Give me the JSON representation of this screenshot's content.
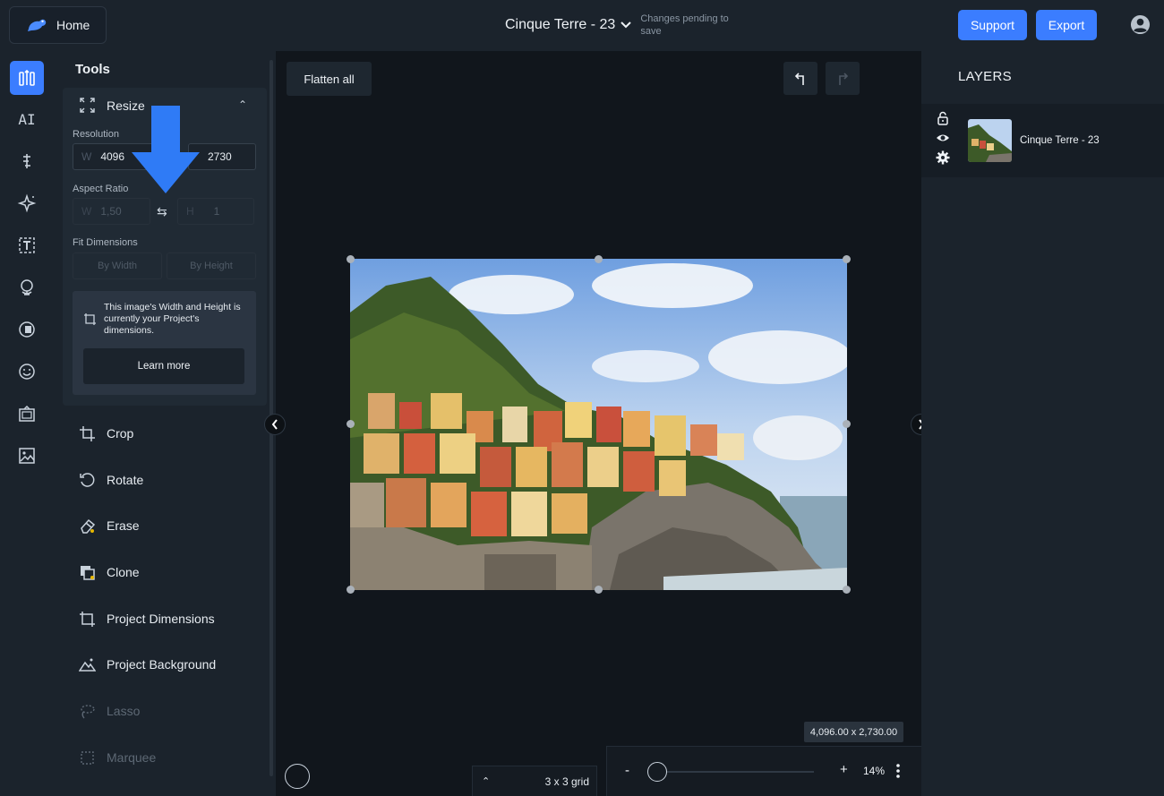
{
  "header": {
    "home_label": "Home",
    "project_title": "Cinque Terre - 23",
    "save_status": "Changes pending to save",
    "support_label": "Support",
    "export_label": "Export"
  },
  "rail": {
    "items": [
      {
        "name": "tools",
        "active": true
      },
      {
        "name": "ai",
        "label": "AI"
      },
      {
        "name": "adjustments"
      },
      {
        "name": "effects"
      },
      {
        "name": "text",
        "label": "T"
      },
      {
        "name": "elements"
      },
      {
        "name": "stickers"
      },
      {
        "name": "emoji"
      },
      {
        "name": "frames"
      },
      {
        "name": "images"
      }
    ]
  },
  "tools_panel": {
    "title": "Tools",
    "resize": {
      "label": "Resize",
      "resolution_label": "Resolution",
      "width_prefix": "W",
      "width_value": "4096",
      "height_value": "2730",
      "aspect_label": "Aspect Ratio",
      "aspect_w_prefix": "W",
      "aspect_w_value": "1,50",
      "aspect_h_prefix": "H",
      "aspect_h_value": "1",
      "fit_label": "Fit Dimensions",
      "fit_by_width": "By Width",
      "fit_by_height": "By Height",
      "info_text": "This image's Width and Height is currently your Project's dimensions.",
      "learn_more": "Learn more"
    },
    "items": [
      {
        "label": "Crop",
        "enabled": true
      },
      {
        "label": "Rotate",
        "enabled": true
      },
      {
        "label": "Erase",
        "enabled": true
      },
      {
        "label": "Clone",
        "enabled": true
      },
      {
        "label": "Project Dimensions",
        "enabled": true
      },
      {
        "label": "Project Background",
        "enabled": true
      },
      {
        "label": "Lasso",
        "enabled": false
      },
      {
        "label": "Marquee",
        "enabled": false
      }
    ]
  },
  "canvas": {
    "flatten_label": "Flatten all",
    "dimensions_badge": "4,096.00 x 2,730.00",
    "grid_label": "3 x 3 grid",
    "zoom_minus": "-",
    "zoom_plus": "+",
    "zoom_value": "14%",
    "zoom_level": 0.14
  },
  "layers": {
    "title": "LAYERS",
    "items": [
      {
        "name": "Cinque Terre - 23"
      }
    ]
  },
  "colors": {
    "accent": "#3b7dff",
    "panel": "#1b232c",
    "canvas": "#11161c"
  }
}
